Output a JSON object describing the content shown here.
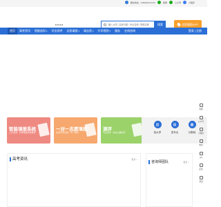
{
  "topbar": {
    "phone": "服务热线：13825601XXXX",
    "weibo": "微博",
    "wechat": "公众号",
    "mini": "小程序"
  },
  "header": {
    "search_placeholder": "输入大学 / 高考分数 / 专业名称 / 院校名称",
    "search_button": "搜索",
    "app_button": "志愿填报APP"
  },
  "nav": {
    "items": [
      {
        "label": "首页",
        "active": true,
        "caret": false
      },
      {
        "label": "高考资讯",
        "active": false,
        "caret": false
      },
      {
        "label": "智能选科",
        "active": false,
        "caret": true
      },
      {
        "label": "学业测评",
        "active": false,
        "caret": false
      },
      {
        "label": "志愿填报",
        "active": false,
        "caret": true
      },
      {
        "label": "填志愿",
        "active": false,
        "caret": true
      },
      {
        "label": "升学规划",
        "active": false,
        "caret": true
      },
      {
        "label": "服务",
        "active": false,
        "caret": false
      },
      {
        "label": "在线咨询",
        "active": false,
        "caret": false
      }
    ],
    "login": "登录 | 注册"
  },
  "cards": [
    {
      "title": "智能填报系统",
      "subtitle": "三步完成 · 科学精准志愿推荐"
    },
    {
      "title": "一对一志愿填报",
      "subtitle": "资深专家全程一对一辅导"
    },
    {
      "title": "测评",
      "subtitle": "专业测评 · 职业兴趣测评"
    }
  ],
  "tools": [
    {
      "label": "找大学",
      "icon": "building-icon",
      "color": "#2b6fd6"
    },
    {
      "label": "查专业",
      "icon": "book-icon",
      "color": "#2b6fd6"
    },
    {
      "label": "分数线",
      "icon": "chart-icon",
      "color": "#2b6fd6"
    }
  ],
  "sidebar": [
    {
      "label": "客服"
    },
    {
      "label": "公众号"
    },
    {
      "label": "小程序"
    },
    {
      "label": "电话"
    },
    {
      "label": "QQ"
    },
    {
      "label": "反馈"
    },
    {
      "label": "顶部"
    }
  ],
  "panels": {
    "news_title": "高考资讯",
    "news_more": "更多 >",
    "team_title": "咨询师团队",
    "team_more": "更多 >"
  }
}
